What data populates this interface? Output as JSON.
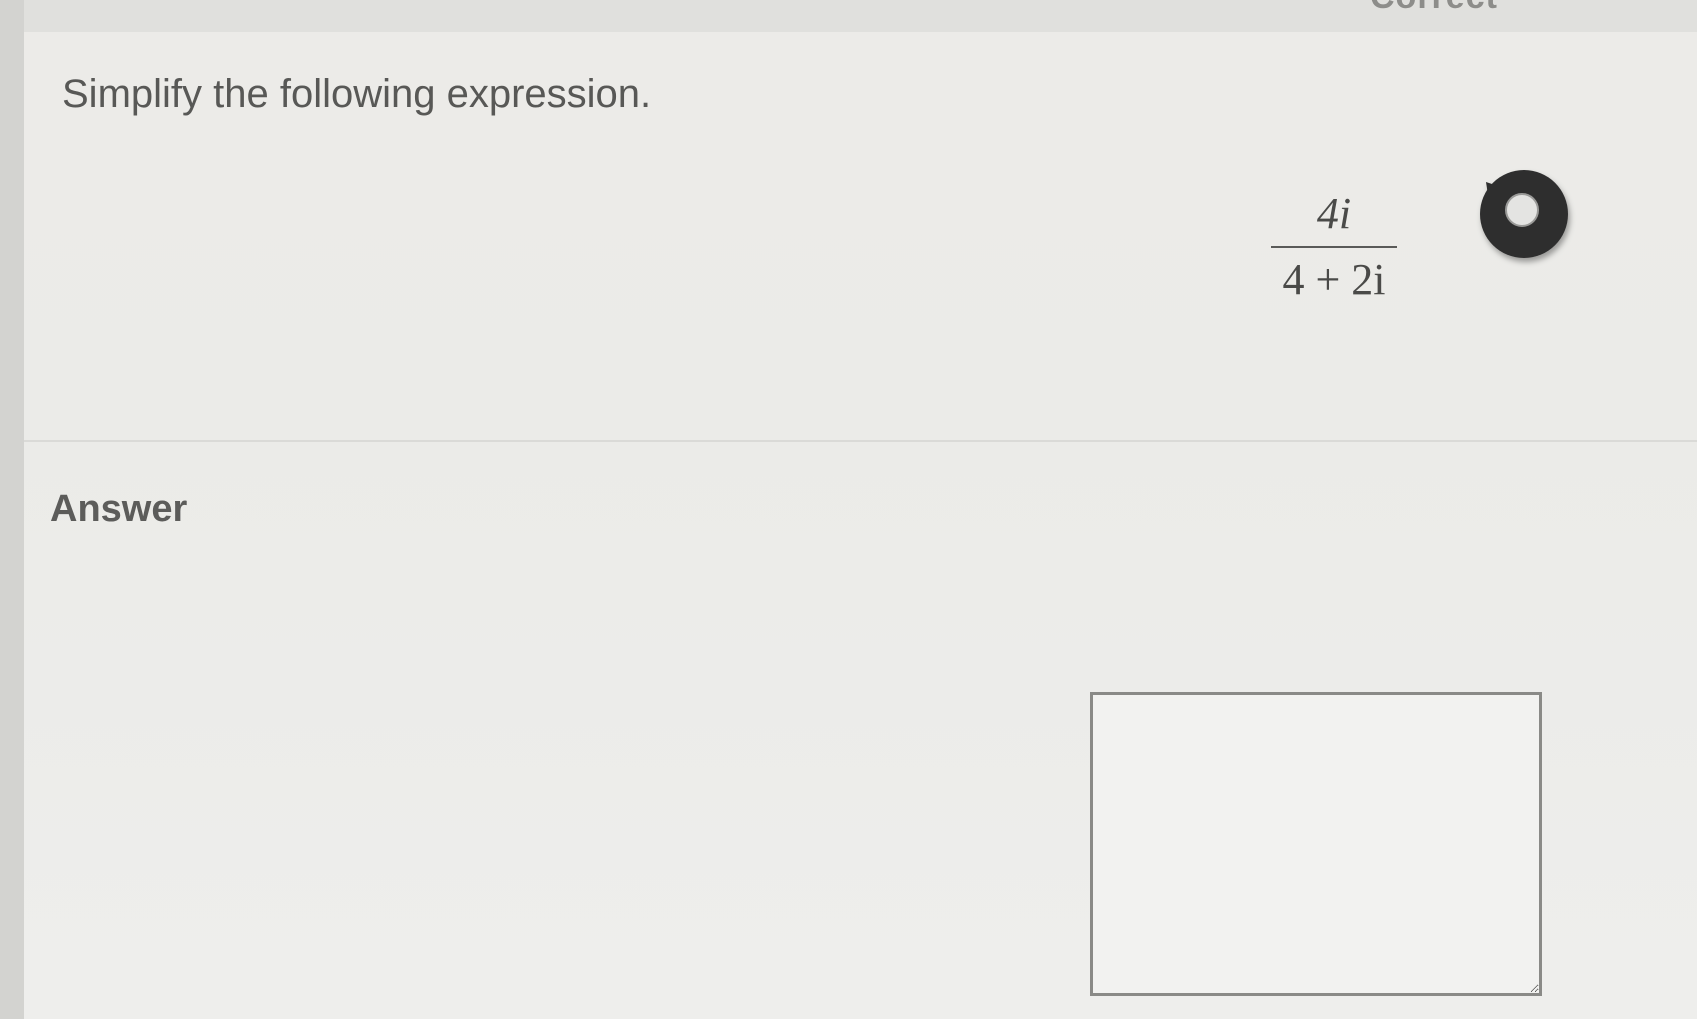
{
  "header": {
    "status_text": "Correct"
  },
  "question": {
    "prompt": "Simplify the following expression.",
    "expression": {
      "numerator": "4i",
      "denominator": "4 + 2i"
    },
    "audio_icon": "speaker-icon"
  },
  "answer": {
    "label": "Answer",
    "value": "",
    "placeholder": ""
  },
  "colors": {
    "background": "#ecebe8",
    "text": "#585856",
    "icon": "#2e2e2e"
  }
}
